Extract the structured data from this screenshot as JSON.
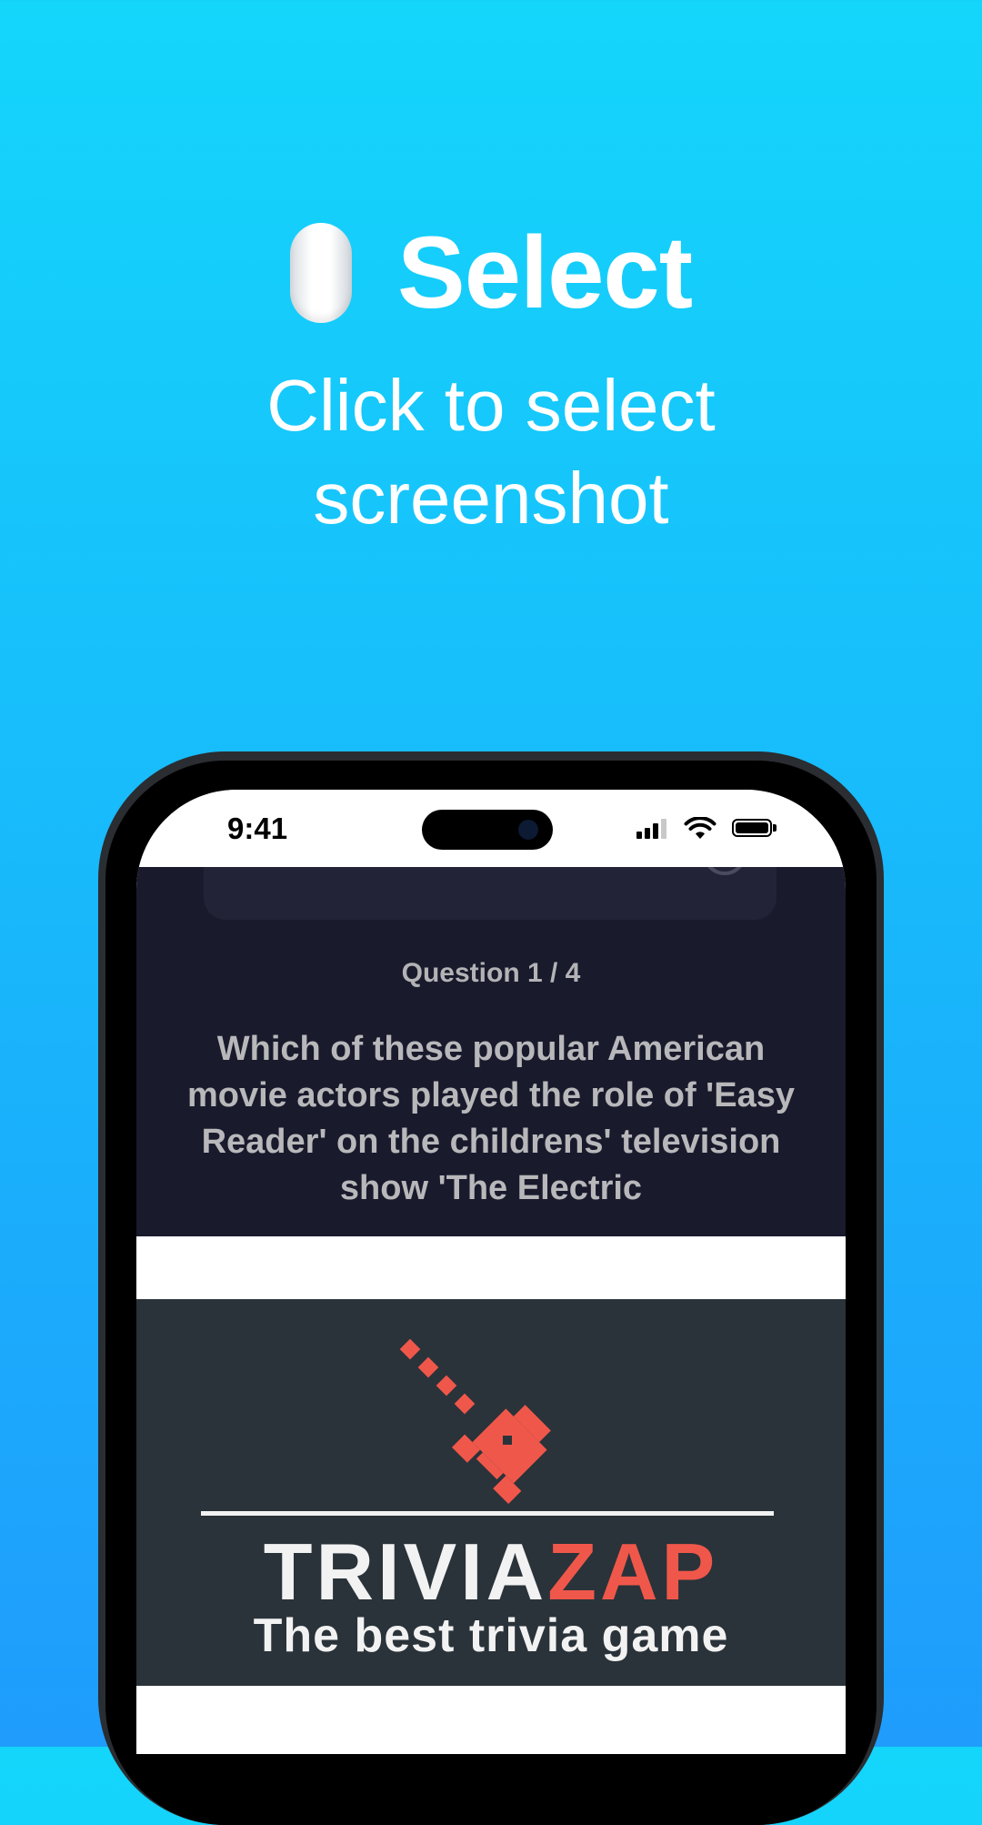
{
  "headline": {
    "icon": "mouse-icon",
    "title": "Select",
    "subtitle": "Click to select screenshot"
  },
  "phone": {
    "status_bar": {
      "time": "9:41",
      "icons": [
        "signal-icon",
        "wifi-icon",
        "battery-icon"
      ]
    },
    "quiz": {
      "timer_icon": "clock-icon",
      "question_counter": "Question 1 / 4",
      "question_text": "Which of these popular American movie actors played the role of 'Easy Reader' on the childrens' television show 'The Electric"
    },
    "logo": {
      "icon": "rocket-icon",
      "word_part1": "TRIVIA",
      "word_part2": "ZAP",
      "tagline": "The best trivia game",
      "accent_color": "#f0574b"
    }
  },
  "colors": {
    "background_top": "#14d6fb",
    "background_bottom": "#1f9cfc",
    "quiz_bg": "#191a2c",
    "logo_bg": "#2a3339"
  }
}
